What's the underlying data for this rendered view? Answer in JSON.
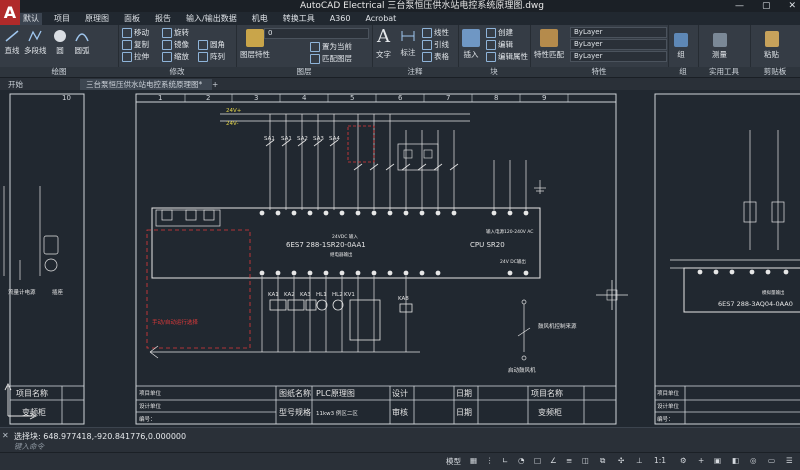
{
  "window": {
    "title": "AutoCAD Electrical    三台泵恒压供水站电控系统原理图.dwg",
    "controls": [
      "—",
      "▢",
      "✕"
    ],
    "logo": "A"
  },
  "menu": [
    "默认",
    "项目",
    "原理图",
    "面板",
    "报告",
    "输入/输出数据",
    "机电",
    "转换工具",
    "A360",
    "Acrobat"
  ],
  "ribbon": {
    "draw": {
      "title": "绘图",
      "line": "直线",
      "polyline": "多段线",
      "circle": "圆",
      "arc": "圆弧"
    },
    "modify": {
      "title": "修改",
      "move": "移动",
      "rotate": "旋转",
      "copy": "复制",
      "mirror": "镜像",
      "stretch": "拉伸",
      "scale": "缩放",
      "array": "阵列",
      "fillet": "圆角"
    },
    "layers": {
      "title": "图层",
      "properties": "图层特性",
      "current": "置为当前",
      "match": "匹配图层",
      "layer_value": "0"
    },
    "annotation": {
      "title": "注释",
      "text": "文字",
      "dim": "标注",
      "leader": "线性",
      "leader2": "引线",
      "table": "表格"
    },
    "block": {
      "title": "块",
      "insert": "插入",
      "create": "创建",
      "edit": "编辑",
      "attr": "编辑属性"
    },
    "properties": {
      "title": "特性",
      "match": "特性匹配",
      "bylayer1": "ByLayer",
      "bylayer2": "ByLayer",
      "bylayer3": "ByLayer"
    },
    "groups": {
      "title": "组",
      "label": "组"
    },
    "utilities": {
      "title": "实用工具",
      "measure": "测量"
    },
    "clipboard": {
      "title": "剪贴板",
      "paste": "粘贴"
    }
  },
  "doc_tabs": {
    "start": "开始",
    "active": "三台泵恒压供水站电控系统原理图*"
  },
  "drawing": {
    "plc_model": "6ES7 288-1SR20-0AA1",
    "cpu": "CPU SR20",
    "input_label": "24VDC 输入",
    "output_label": "继电器输出",
    "power_label": "输入电源120-240V AC",
    "dc_out": "24V DC输出",
    "ao_model": "6ES7 288-3AQ04-0AA0",
    "ao_label": "模拟量输出",
    "left_labels": [
      "流量计电源",
      "插座"
    ],
    "blower_control": "鼓风机控制来源",
    "blower_start": "启动鼓风机",
    "red_note": "手动/自动运行选择",
    "switches": [
      "SA1",
      "SA1",
      "SA2",
      "SA3",
      "SA4"
    ],
    "lamps": [
      "KA1",
      "KA2",
      "KA3",
      "HL1",
      "HL2"
    ],
    "kv1": "KV1",
    "ka8": "KA8",
    "power_24": "24V+",
    "power_0": "24V-",
    "top_nums": [
      "1",
      "2",
      "3",
      "4",
      "5",
      "6",
      "7",
      "8",
      "9",
      "10"
    ],
    "title_block": {
      "project_unit": "项目单位",
      "design_unit": "设计单位",
      "number": "编号：",
      "drawing_name": "图纸名称",
      "drawing_value": "PLC原理图",
      "model_spec": "型号规格",
      "model_value": "11kw3 例区二区",
      "design": "设计",
      "review": "审核",
      "date": "日期",
      "project_name": "项目名称",
      "project_value": "变频柜",
      "left_project": "项目名称",
      "left_value": "变频柜"
    }
  },
  "command": {
    "output": "选择块: 648.977418,-920.841776,0.000000",
    "placeholder": "键入命令"
  },
  "status": {
    "model": "模型",
    "scale": "1:1"
  },
  "colors": {
    "canvas": "#212830",
    "ribbon": "#353c45",
    "accent_red": "#b02a2a",
    "wire_white": "#e6e6e6",
    "wire_yellow": "#e8d84a",
    "wire_green": "#3fd04f",
    "wire_red": "#e03a3a",
    "wire_cyan": "#4fd6e0"
  }
}
